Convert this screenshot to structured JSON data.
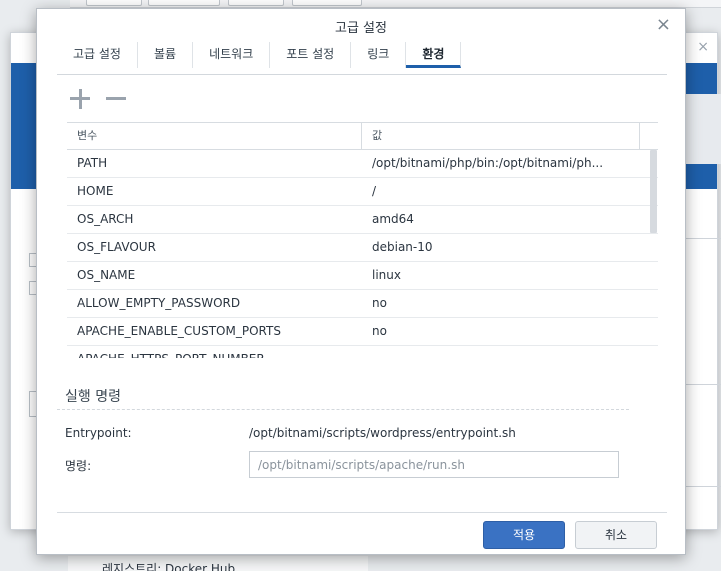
{
  "dialog": {
    "title": "고급 설정",
    "close_icon": "×"
  },
  "tabs": [
    {
      "label": "고급 설정",
      "active": false
    },
    {
      "label": "볼륨",
      "active": false
    },
    {
      "label": "네트워크",
      "active": false
    },
    {
      "label": "포트 설정",
      "active": false
    },
    {
      "label": "링크",
      "active": false
    },
    {
      "label": "환경",
      "active": true
    }
  ],
  "toolbar": {
    "add_icon": "plus-icon",
    "remove_icon": "minus-icon"
  },
  "env_table": {
    "columns": [
      "변수",
      "값"
    ],
    "rows": [
      {
        "key": "PATH",
        "value": "/opt/bitnami/php/bin:/opt/bitnami/ph..."
      },
      {
        "key": "HOME",
        "value": "/"
      },
      {
        "key": "OS_ARCH",
        "value": "amd64"
      },
      {
        "key": "OS_FLAVOUR",
        "value": "debian-10"
      },
      {
        "key": "OS_NAME",
        "value": "linux"
      },
      {
        "key": "ALLOW_EMPTY_PASSWORD",
        "value": "no"
      },
      {
        "key": "APACHE_ENABLE_CUSTOM_PORTS",
        "value": "no"
      },
      {
        "key": "APACHE_HTTPS_PORT_NUMBER",
        "value": ""
      }
    ]
  },
  "exec": {
    "section_title": "실행 명령",
    "entrypoint_label": "Entrypoint:",
    "entrypoint_value": "/opt/bitnami/scripts/wordpress/entrypoint.sh",
    "command_label": "명령:",
    "command_placeholder": "/opt/bitnami/scripts/apache/run.sh"
  },
  "footer": {
    "apply_label": "적용",
    "cancel_label": "취소"
  },
  "background": {
    "bottom_text": "레지스트리: Docker Hub",
    "close_icon": "×"
  },
  "colors": {
    "accent": "#1e5faa",
    "primary_button": "#3a72c3"
  }
}
